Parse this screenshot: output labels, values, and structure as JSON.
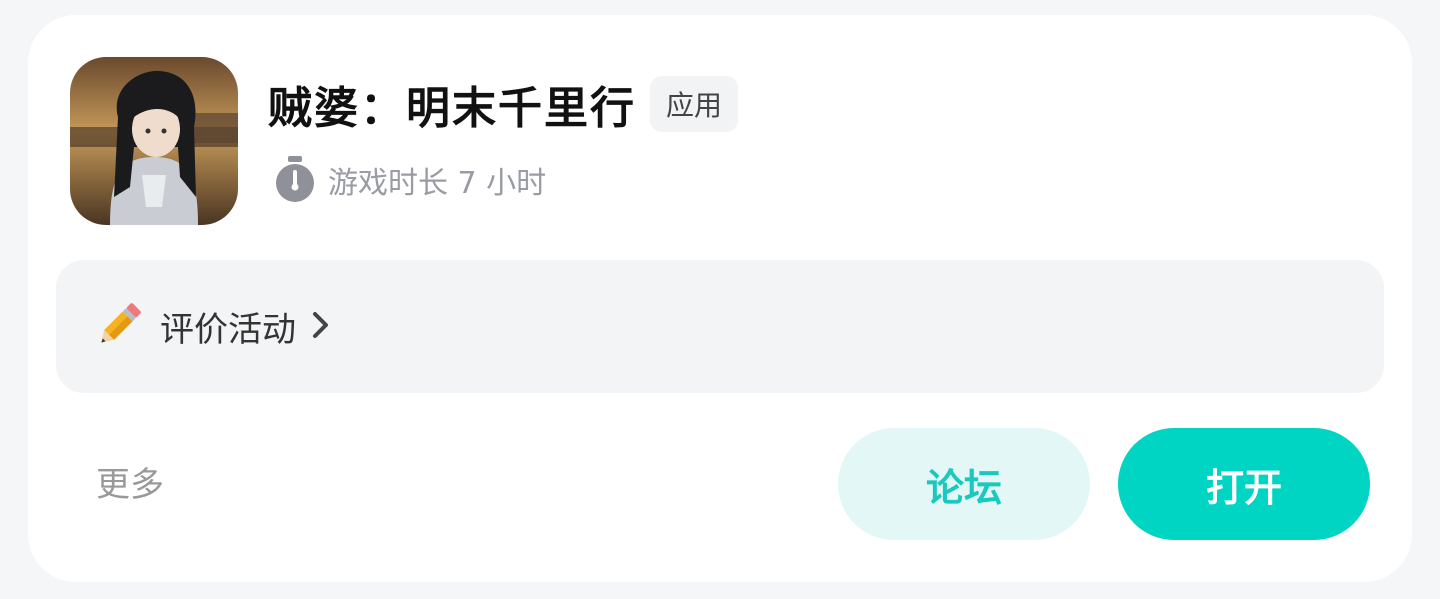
{
  "app": {
    "title": "贼婆：明末千里行",
    "type_badge": "应用",
    "playtime": "游戏时长 7 小时"
  },
  "activity": {
    "label": "评价活动"
  },
  "footer": {
    "more_label": "更多",
    "forum_label": "论坛",
    "open_label": "打开"
  },
  "icons": {
    "app_icon": "game-character-art-icon",
    "playtime": "stopwatch-icon",
    "activity": "pencil-icon",
    "activity_chevron": "chevron-right-icon"
  },
  "colors": {
    "accent": "#00d4c3",
    "forum_bg": "#e3f8f6",
    "forum_text": "#19c9bd",
    "muted_text": "#9a9ca3"
  }
}
